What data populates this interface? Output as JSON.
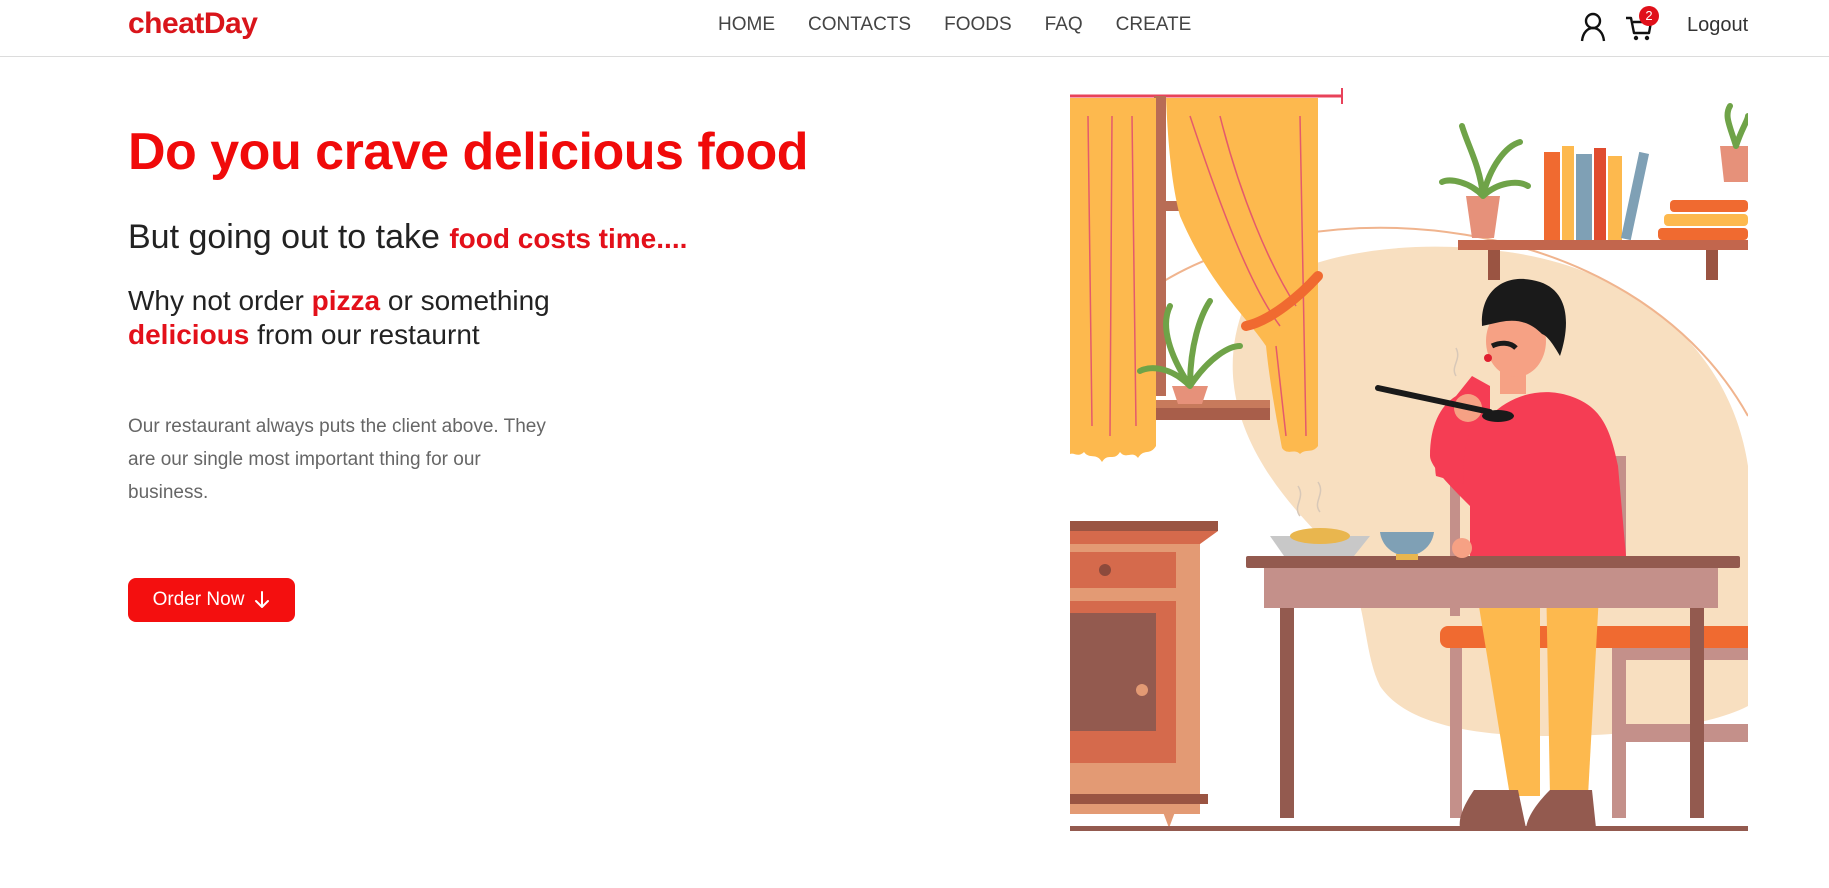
{
  "nav": {
    "brand": "cheatDay",
    "links": [
      "HOME",
      "CONTACTS",
      "FOODS",
      "FAQ",
      "CREATE"
    ],
    "cart_count": "2",
    "logout_label": "Logout"
  },
  "hero": {
    "title": "Do you crave delicious food",
    "subtitle_prefix": "But going out to take ",
    "subtitle_highlight": "food costs time....",
    "why_part1": "Why not order ",
    "why_highlight1": "pizza",
    "why_part2": " or something",
    "why_highlight2": "delicious",
    "why_part3": " from our restaurnt",
    "description": "Our restaurant always puts the client above. They are our single most important thing for our business.",
    "cta_label": "Order Now"
  },
  "colors": {
    "brand": "#d9151b",
    "accent": "#f40f0f"
  },
  "icons": {
    "user": "user-icon",
    "cart": "cart-icon",
    "cta": "arrow-down-icon"
  }
}
